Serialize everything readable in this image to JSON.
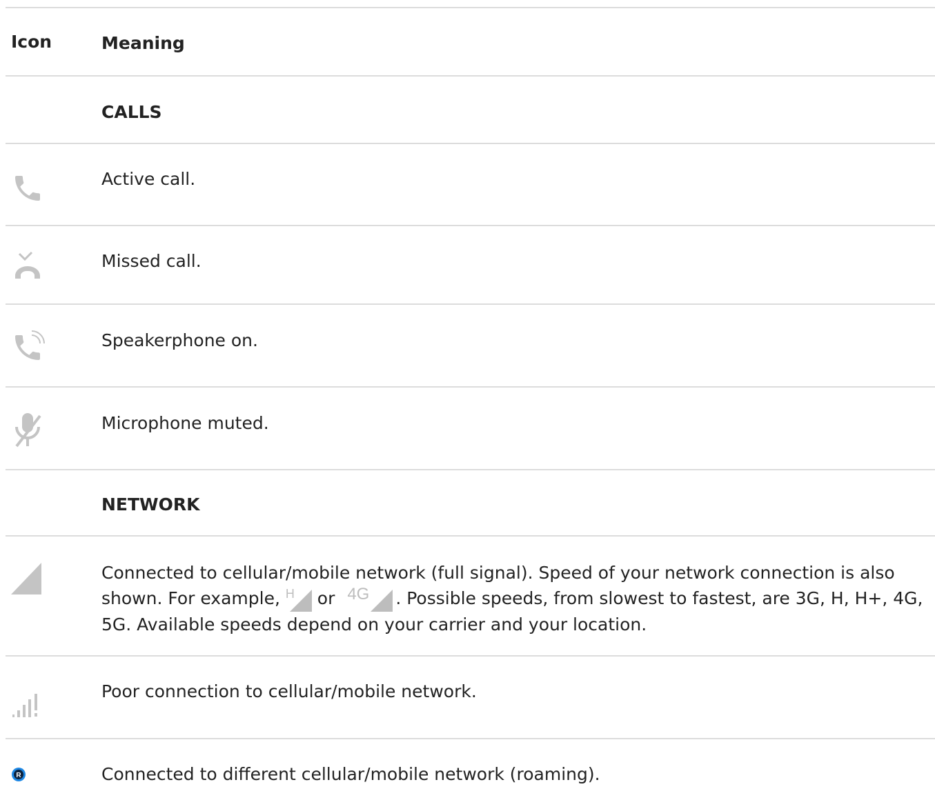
{
  "table": {
    "col_icon": "Icon",
    "col_meaning": "Meaning",
    "section_calls": "CALLS",
    "section_network": "NETWORK",
    "rows": {
      "active_call": "Active call.",
      "missed_call": "Missed call.",
      "speakerphone": "Speakerphone on.",
      "mic_muted": "Microphone muted.",
      "full_signal_a": "Connected to cellular/mobile network (full signal). Speed of your network connection is also shown. For example, ",
      "full_signal_or": " or ",
      "full_signal_b": ". Possible speeds, from slowest to fastest, are 3G, H, H+, 4G, 5G. Available speeds depend on your carrier and your location.",
      "example_h": "H",
      "example_4g": "4G",
      "poor_connection": "Poor connection to cellular/mobile network.",
      "roaming": "Connected to different cellular/mobile network (roaming).",
      "roaming_badge": "R"
    }
  },
  "colors": {
    "icon_gray": "#bdbdbd",
    "rule": "#dcdcdc",
    "roaming_blue": "#1e88e5"
  }
}
